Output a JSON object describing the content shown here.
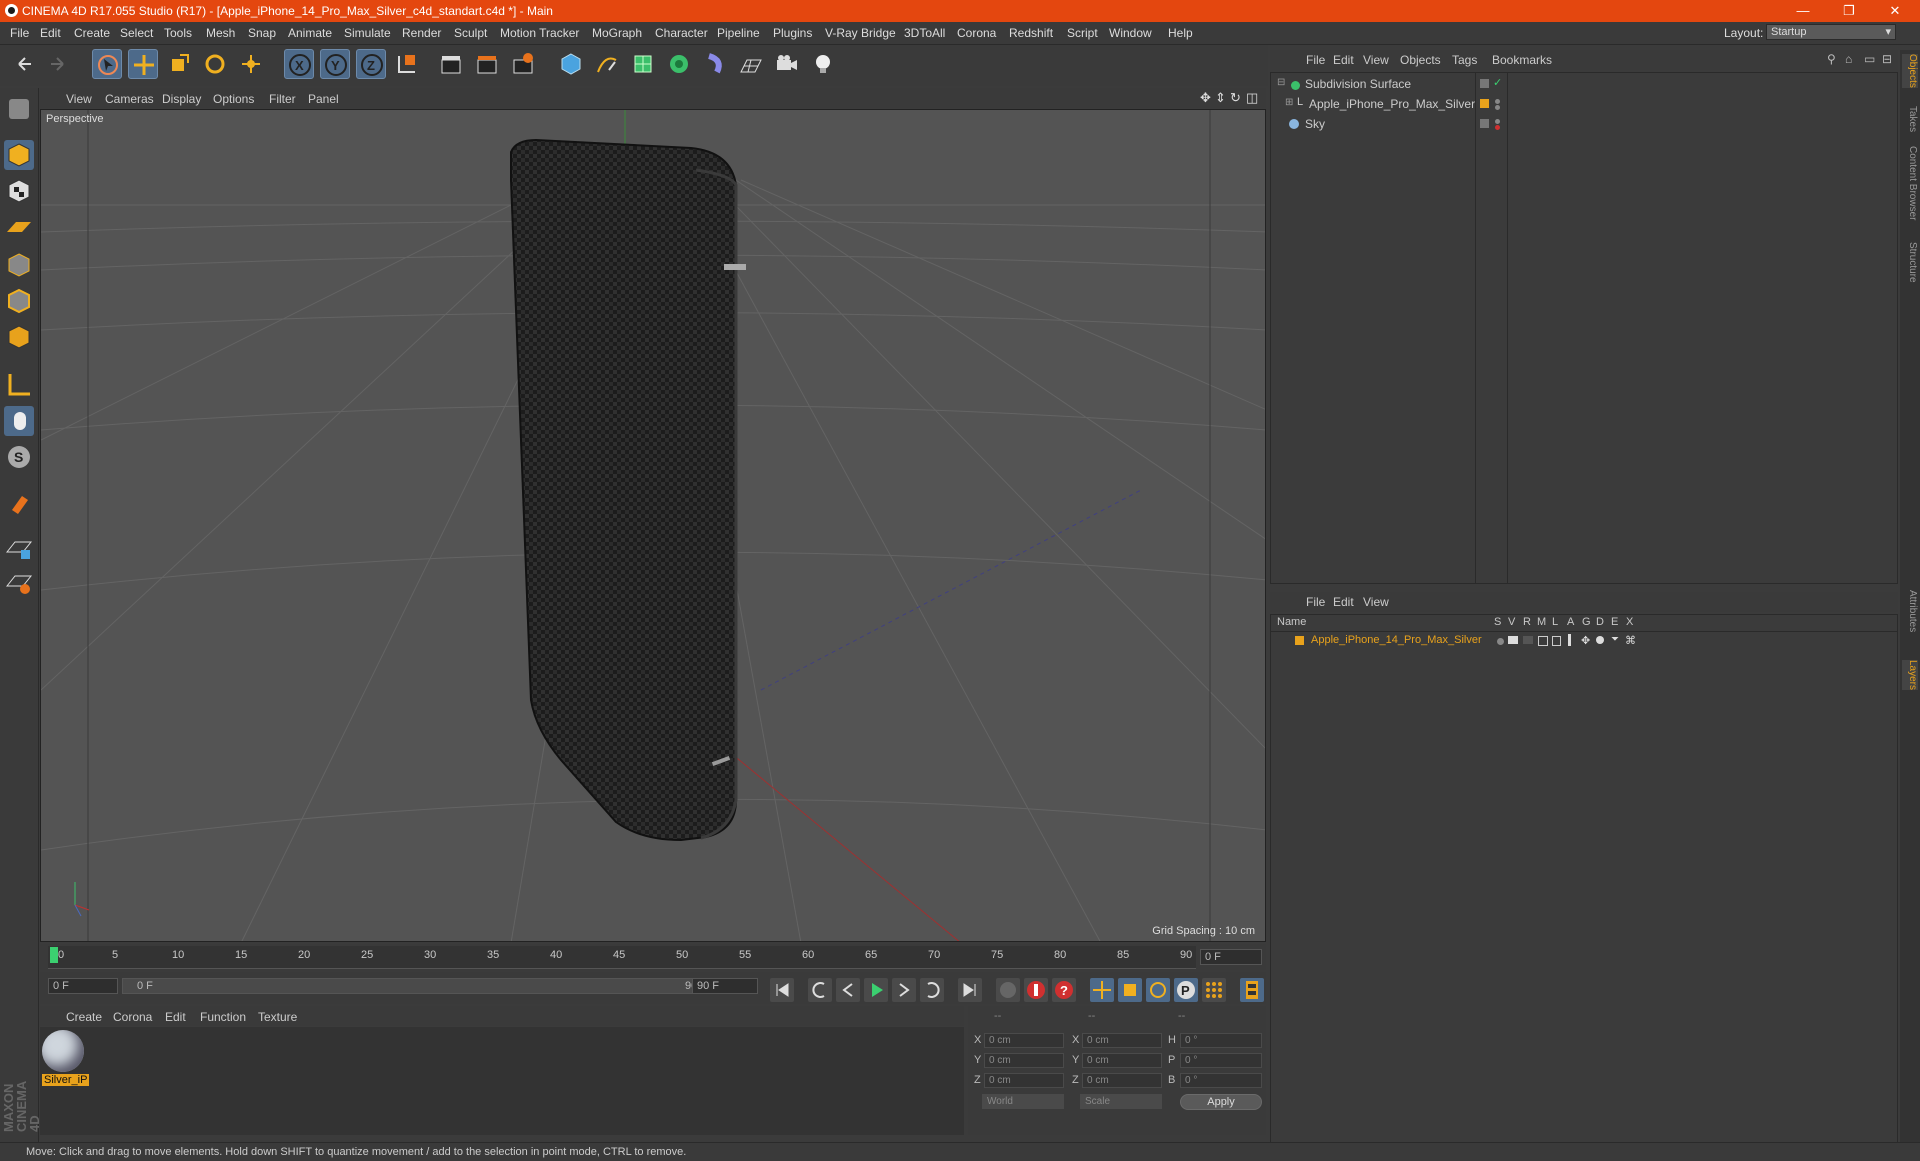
{
  "window": {
    "title": "CINEMA 4D R17.055 Studio (R17) - [Apple_iPhone_14_Pro_Max_Silver_c4d_standart.c4d *] - Main",
    "minimize": "—",
    "maximize": "❐",
    "close": "✕"
  },
  "menubar": {
    "items": [
      "File",
      "Edit",
      "Create",
      "Select",
      "Tools",
      "Mesh",
      "Snap",
      "Animate",
      "Simulate",
      "Render",
      "Sculpt",
      "Motion Tracker",
      "MoGraph",
      "Character",
      "Pipeline",
      "Plugins",
      "V-Ray Bridge",
      "3DToAll",
      "Corona",
      "Redshift",
      "Script",
      "Window",
      "Help"
    ],
    "layout_label": "Layout:",
    "layout_value": "Startup"
  },
  "viewport": {
    "menu": [
      "View",
      "Cameras",
      "Display",
      "Options",
      "Filter",
      "Panel"
    ],
    "label": "Perspective",
    "grid_spacing": "Grid Spacing : 10 cm"
  },
  "timeline": {
    "ticks": [
      "0",
      "5",
      "10",
      "15",
      "20",
      "25",
      "30",
      "35",
      "40",
      "45",
      "50",
      "55",
      "60",
      "65",
      "70",
      "75",
      "80",
      "85",
      "90"
    ],
    "current_frame": "0 F",
    "start_field": "0 F",
    "slider_start": "0 F",
    "slider_end": "90 F",
    "end_field": "90 F"
  },
  "material_manager": {
    "menu": [
      "Create",
      "Corona",
      "Edit",
      "Function",
      "Texture"
    ],
    "material_name": "Silver_iP"
  },
  "coordinates": {
    "col_headers": [
      "--",
      "--",
      "--"
    ],
    "pos_labels": [
      "X",
      "Y",
      "Z"
    ],
    "pos_values": [
      "0 cm",
      "0 cm",
      "0 cm"
    ],
    "size_labels": [
      "X",
      "Y",
      "Z"
    ],
    "size_values": [
      "0 cm",
      "0 cm",
      "0 cm"
    ],
    "rot_labels": [
      "H",
      "P",
      "B"
    ],
    "rot_values": [
      "0 °",
      "0 °",
      "0 °"
    ],
    "mode_select": "World",
    "size_select": "Scale",
    "apply_label": "Apply"
  },
  "object_manager": {
    "menu": [
      "File",
      "Edit",
      "View",
      "Objects",
      "Tags",
      "Bookmarks"
    ],
    "objects": [
      {
        "name": "Subdivision Surface"
      },
      {
        "name": "Apple_iPhone_Pro_Max_Silver"
      },
      {
        "name": "Sky"
      }
    ]
  },
  "layer_manager": {
    "menu": [
      "File",
      "Edit",
      "View"
    ],
    "columns": [
      "Name",
      "S",
      "V",
      "R",
      "M",
      "L",
      "A",
      "G",
      "D",
      "E",
      "X"
    ],
    "layer_name": "Apple_iPhone_14_Pro_Max_Silver",
    "layer_color": "#e8a21c"
  },
  "right_tabs": [
    "Objects",
    "Takes",
    "Content Browser",
    "Structure",
    "Attributes",
    "Layers"
  ],
  "status": "Move: Click and drag to move elements. Hold down SHIFT to quantize movement / add to the selection in point mode, CTRL to remove.",
  "branding": "MAXON CINEMA 4D",
  "colors": {
    "title_bar": "#e4470f",
    "active_tool": "#4d6a8a",
    "layer_orange": "#e8a21c"
  }
}
